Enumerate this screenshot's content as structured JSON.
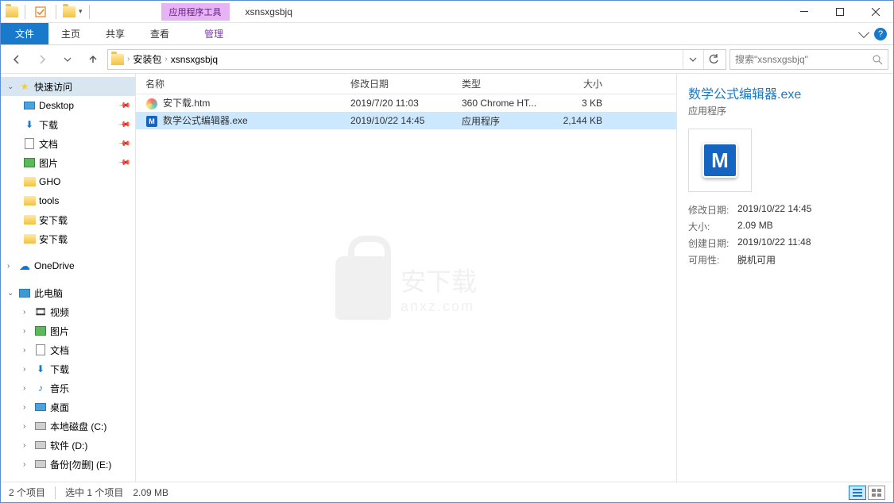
{
  "window": {
    "tools_tab": "应用程序工具",
    "title": "xsnsxgsbjq"
  },
  "ribbon": {
    "file": "文件",
    "home": "主页",
    "share": "共享",
    "view": "查看",
    "manage": "管理"
  },
  "breadcrumb": {
    "item1": "安装包",
    "item2": "xsnsxgsbjq"
  },
  "search": {
    "placeholder": "搜索\"xsnsxgsbjq\""
  },
  "sidebar": {
    "quick_access": "快速访问",
    "items": [
      {
        "label": "Desktop",
        "pinned": true
      },
      {
        "label": "下载",
        "pinned": true
      },
      {
        "label": "文档",
        "pinned": true
      },
      {
        "label": "图片",
        "pinned": true
      },
      {
        "label": "GHO",
        "pinned": false
      },
      {
        "label": "tools",
        "pinned": false
      },
      {
        "label": "安下载",
        "pinned": false
      },
      {
        "label": "安下载",
        "pinned": false
      }
    ],
    "onedrive": "OneDrive",
    "this_pc": "此电脑",
    "pc_items": [
      {
        "label": "视频"
      },
      {
        "label": "图片"
      },
      {
        "label": "文档"
      },
      {
        "label": "下载"
      },
      {
        "label": "音乐"
      },
      {
        "label": "桌面"
      },
      {
        "label": "本地磁盘 (C:)"
      },
      {
        "label": "软件 (D:)"
      },
      {
        "label": "备份[勿删] (E:)"
      }
    ]
  },
  "columns": {
    "name": "名称",
    "date": "修改日期",
    "type": "类型",
    "size": "大小"
  },
  "files": [
    {
      "name": "安下载.htm",
      "date": "2019/7/20 11:03",
      "type": "360 Chrome HT...",
      "size": "3 KB",
      "icon": "htm"
    },
    {
      "name": "数学公式编辑器.exe",
      "date": "2019/10/22 14:45",
      "type": "应用程序",
      "size": "2,144 KB",
      "icon": "exe",
      "selected": true
    }
  ],
  "details": {
    "title": "数学公式编辑器.exe",
    "type": "应用程序",
    "props": [
      {
        "label": "修改日期:",
        "value": "2019/10/22 14:45"
      },
      {
        "label": "大小:",
        "value": "2.09 MB"
      },
      {
        "label": "创建日期:",
        "value": "2019/10/22 11:48"
      },
      {
        "label": "可用性:",
        "value": "脱机可用"
      }
    ]
  },
  "statusbar": {
    "count": "2 个项目",
    "selected": "选中 1 个项目",
    "size": "2.09 MB"
  },
  "watermark": {
    "text": "安下载",
    "sub": "anxz.com"
  }
}
